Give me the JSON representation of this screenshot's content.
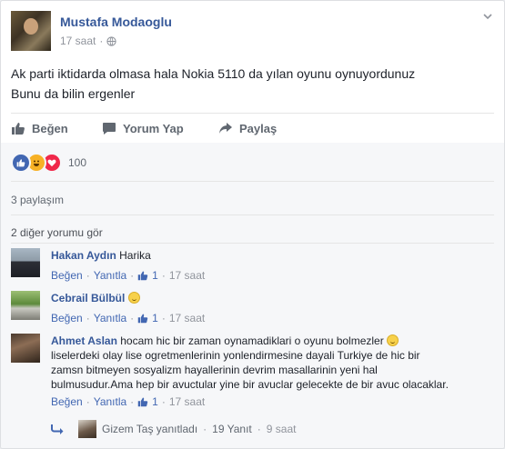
{
  "post": {
    "author": "Mustafa Modaoglu",
    "time": "17 saat",
    "text_lines": [
      "Ak parti iktidarda olmasa hala Nokia 5110 da yılan oyunu oynuyordunuz",
      "Bunu da bilin ergenler"
    ]
  },
  "actions": {
    "like": "Beğen",
    "comment": "Yorum Yap",
    "share": "Paylaş"
  },
  "reactions": {
    "count": "100"
  },
  "shares": "3 paylaşım",
  "more_comments": "2 diğer yorumu gör",
  "comments": [
    {
      "name": "Hakan Aydın",
      "text": "Harika",
      "like": "Beğen",
      "reply": "Yanıtla",
      "likes": "1",
      "time": "17 saat"
    },
    {
      "name": "Cebrail Bülbül",
      "text": "",
      "like": "Beğen",
      "reply": "Yanıtla",
      "likes": "1",
      "time": "17 saat"
    },
    {
      "name": "Ahmet Aslan",
      "text_lines": [
        "hocam hic bir zaman oynamadiklari o oyunu bolmezler",
        "liselerdeki olay lise ogretmenlerinin yonlendirmesine dayali Turkiye de hic bir",
        "zamsn bitmeyen sosyalizm hayallerinin devrim masallarinin yeni hal",
        "bulmusudur.Ama hep bir avuctular yine bir avuclar gelecekte de bir avuc olacaklar."
      ],
      "like": "Beğen",
      "reply": "Yanıtla",
      "likes": "1",
      "time": "17 saat"
    }
  ],
  "reply": {
    "name": "Gizem Taş yanıtladı",
    "count": "19 Yanıt",
    "time": "9 saat"
  },
  "sep": "·",
  "colors": {
    "link": "#365899",
    "accent": "#4267b2",
    "meta": "#90949c"
  },
  "icons": {
    "chevron": "chevron-down-icon",
    "globe": "globe-icon",
    "like": "thumbs-up-icon",
    "comment": "speech-bubble-icon",
    "share": "share-arrow-icon",
    "reply": "reply-arrow-icon"
  }
}
